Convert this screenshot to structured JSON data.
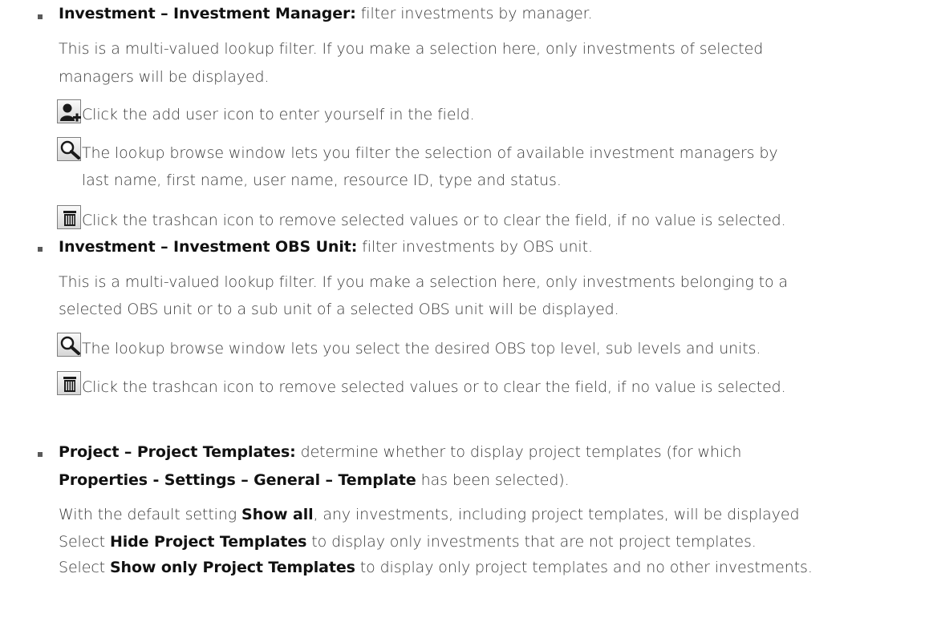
{
  "sections": {
    "manager": {
      "title": "Investment – Investment Manager:",
      "title_rest": " filter investments by manager.",
      "desc_line1": "This is a multi-valued lookup filter. If you make a selection here, only investments of selected",
      "desc_line2": "managers will be displayed.",
      "add_user_text": "Click the add user icon to enter yourself in the field.",
      "lookup_text_line1": "The lookup browse window lets you filter the selection of available investment managers by",
      "lookup_text_line2": "last name, first name, user name, resource ID, type and status.",
      "trash_text": "Click the trashcan icon to remove selected values or to clear the field, if no value is selected."
    },
    "obs": {
      "title": "Investment – Investment OBS Unit:",
      "title_rest": " filter investments by OBS unit.",
      "desc_line1": "This is a multi-valued lookup filter. If you make a selection here, only investments belonging to a",
      "desc_line2": "selected OBS unit or to a sub unit of a selected OBS unit will be displayed.",
      "lookup_text": "The lookup browse window lets you select the desired OBS top level, sub levels and units.",
      "trash_text": "Click the trashcan icon to remove selected values or to clear the field, if no value is selected."
    },
    "templates": {
      "title": "Project – Project Templates:",
      "title_rest": " determine whether to display project templates (for which",
      "path": "Properties - Settings – General – Template",
      "path_rest": " has been selected).",
      "default_pre": "With the default setting ",
      "default_bold": "Show all",
      "default_post": ", any investments, including project templates, will be displayed",
      "hide_pre": "Select ",
      "hide_bold": "Hide Project Templates",
      "hide_post": " to display only investments that are not project templates.",
      "only_pre": "Select ",
      "only_bold": "Show only Project Templates",
      "only_post": " to display only project templates and no other investments."
    }
  },
  "icons": {
    "add_user": "add-user-icon",
    "lookup": "magnifier-icon",
    "trash": "trashcan-icon"
  }
}
